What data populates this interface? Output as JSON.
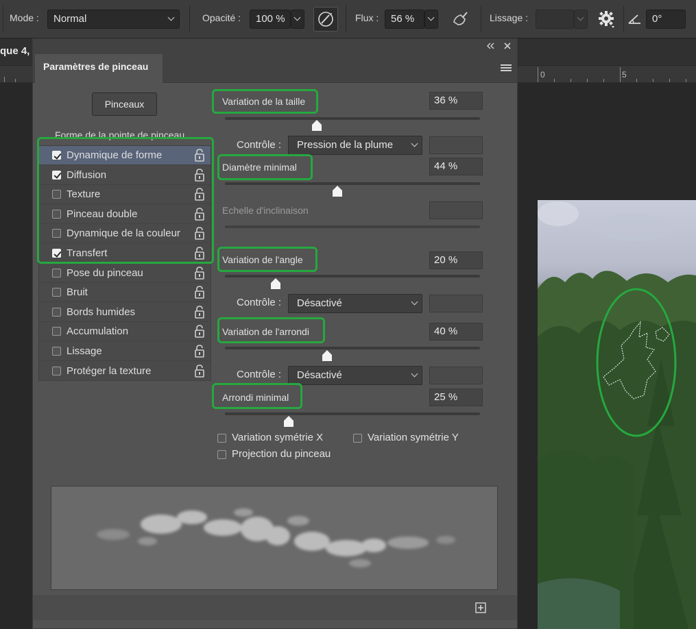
{
  "toolbar": {
    "mode_label": "Mode :",
    "mode_value": "Normal",
    "opacity_label": "Opacité :",
    "opacity_value": "100 %",
    "flow_label": "Flux :",
    "flow_value": "56 %",
    "smoothing_label": "Lissage :",
    "smoothing_value": "",
    "angle_value": "0°",
    "icons": [
      "pressure-opacity-icon",
      "airbrush-icon",
      "gear-icon",
      "angle-icon"
    ]
  },
  "document": {
    "tab_label": "que 4,",
    "ruler_numbers": [
      "0",
      "5"
    ]
  },
  "panel": {
    "title": "Paramètres de pinceau",
    "header_icons": [
      "collapse-icon",
      "close-icon",
      "panel-menu-icon"
    ],
    "brushes_button": "Pinceaux",
    "section_label": "Forme de la pointe de pinceau",
    "items": [
      {
        "label": "Dynamique de forme",
        "checked": true,
        "selected": true
      },
      {
        "label": "Diffusion",
        "checked": true,
        "selected": false
      },
      {
        "label": "Texture",
        "checked": false,
        "selected": false
      },
      {
        "label": "Pinceau double",
        "checked": false,
        "selected": false
      },
      {
        "label": "Dynamique de la couleur",
        "checked": false,
        "selected": false
      },
      {
        "label": "Transfert",
        "checked": true,
        "selected": false
      },
      {
        "label": "Pose du pinceau",
        "checked": false,
        "selected": false
      },
      {
        "label": "Bruit",
        "checked": false,
        "selected": false
      },
      {
        "label": "Bords humides",
        "checked": false,
        "selected": false
      },
      {
        "label": "Accumulation",
        "checked": false,
        "selected": false
      },
      {
        "label": "Lissage",
        "checked": false,
        "selected": false
      },
      {
        "label": "Protéger la texture",
        "checked": false,
        "selected": false
      }
    ],
    "params": {
      "size_jitter": {
        "label": "Variation de la taille",
        "value": "36 %",
        "level": 0.36
      },
      "control_1": {
        "label": "Contrôle :",
        "value": "Pression de la plume"
      },
      "min_diameter": {
        "label": "Diamètre minimal",
        "value": "44 %",
        "level": 0.44
      },
      "tilt_scale": {
        "label": "Echelle d'inclinaison",
        "value": ""
      },
      "angle_jitter": {
        "label": "Variation de l'angle",
        "value": "20 %",
        "level": 0.2
      },
      "control_2": {
        "label": "Contrôle :",
        "value": "Désactivé"
      },
      "roundness_jitter": {
        "label": "Variation de l'arrondi",
        "value": "40 %",
        "level": 0.4
      },
      "control_3": {
        "label": "Contrôle :",
        "value": "Désactivé"
      },
      "min_roundness": {
        "label": "Arrondi minimal",
        "value": "25 %",
        "level": 0.25
      }
    },
    "flip_x": {
      "label": "Variation symétrie X",
      "checked": false
    },
    "flip_y": {
      "label": "Variation symétrie Y",
      "checked": false
    },
    "projection": {
      "label": "Projection du pinceau",
      "checked": false
    }
  },
  "colors": {
    "highlight": "#26a83f",
    "selected_row": "#596479",
    "panel_bg": "#535353"
  }
}
